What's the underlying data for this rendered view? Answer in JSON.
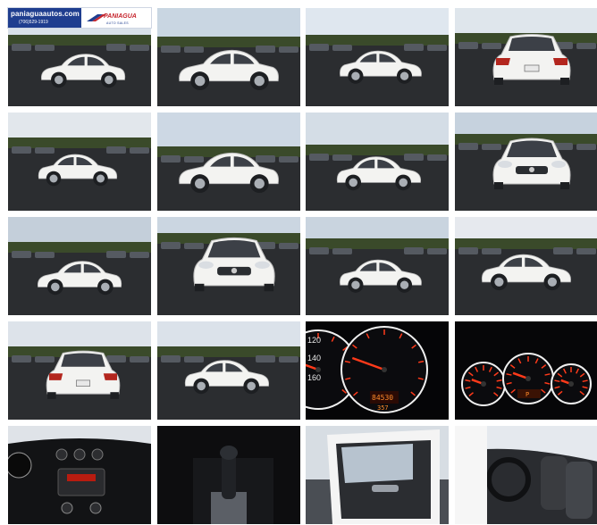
{
  "dealer": {
    "website": "paniaguaautos.com",
    "phone": "(706)529-1919",
    "brand_name": "PANIAGUA",
    "brand_sub": "AUTO SALES"
  },
  "gallery": {
    "photos": [
      {
        "view": "exterior-front-left-with-watermark"
      },
      {
        "view": "exterior-left-side"
      },
      {
        "view": "exterior-rear-right"
      },
      {
        "view": "exterior-rear"
      },
      {
        "view": "exterior-rear-left"
      },
      {
        "view": "exterior-left-profile"
      },
      {
        "view": "exterior-front-right"
      },
      {
        "view": "exterior-front"
      },
      {
        "view": "exterior-front-left"
      },
      {
        "view": "exterior-front-low"
      },
      {
        "view": "exterior-front-right-low"
      },
      {
        "view": "exterior-rear-right-low"
      },
      {
        "view": "exterior-rear-low"
      },
      {
        "view": "exterior-rear-right-quarter"
      },
      {
        "view": "gauge-cluster-closeup"
      },
      {
        "view": "gauge-cluster-full"
      },
      {
        "view": "center-console-dashboard"
      },
      {
        "view": "gear-shifter"
      },
      {
        "view": "driver-door-interior"
      },
      {
        "view": "front-seats-interior"
      }
    ]
  },
  "cluster": {
    "speedo_ticks": [
      "120",
      "140",
      "160"
    ],
    "odometer": "84530",
    "trip": "357",
    "gear": "P"
  },
  "colors": {
    "car_white": "#f3f3f1",
    "asphalt": "#2b2d30",
    "sky": "#c9d6e2",
    "trees": "#3a4a2a",
    "gauge_red": "#ff3a1a",
    "gauge_ring": "#f0f0f0",
    "watermark_blue": "#1f3e8f",
    "watermark_red": "#c6262e"
  }
}
